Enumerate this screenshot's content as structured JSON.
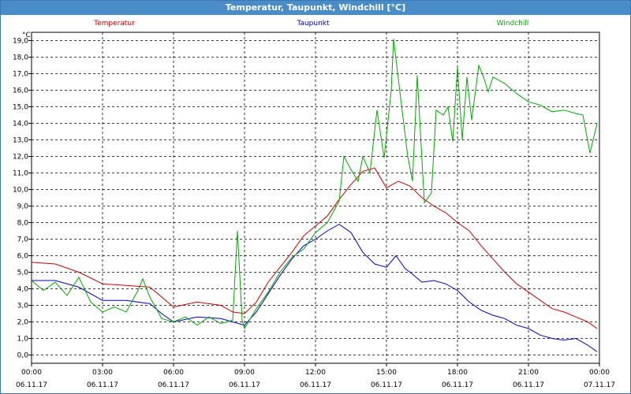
{
  "window": {
    "title": "Temperatur, Taupunkt, Windchill [°C]"
  },
  "chart_data": {
    "type": "line",
    "title": "Temperatur, Taupunkt, Windchill [°C]",
    "yunit": "°C",
    "ylim": [
      -0.5,
      19.5
    ],
    "yticks": [
      "19,0",
      "18,0",
      "17,0",
      "16,0",
      "15,0",
      "14,0",
      "13,0",
      "12,0",
      "11,0",
      "10,0",
      "9,0",
      "8,0",
      "7,0",
      "6,0",
      "5,0",
      "4,0",
      "3,0",
      "2,0",
      "1,0",
      "0,0"
    ],
    "xlim": [
      0,
      24
    ],
    "xticks": [
      {
        "time": "00:00",
        "date": "06.11.17"
      },
      {
        "time": "03:00",
        "date": "06.11.17"
      },
      {
        "time": "06:00",
        "date": "06.11.17"
      },
      {
        "time": "09:00",
        "date": "06.11.17"
      },
      {
        "time": "12:00",
        "date": "06.11.17"
      },
      {
        "time": "15:00",
        "date": "06.11.17"
      },
      {
        "time": "18:00",
        "date": "06.11.17"
      },
      {
        "time": "21:00",
        "date": "06.11.17"
      },
      {
        "time": "00:00",
        "date": "07.11.17"
      }
    ],
    "grid": true,
    "legend_position": "top",
    "series": [
      {
        "name": "Temperatur",
        "color": "#cc0000",
        "points": [
          [
            0,
            5.6
          ],
          [
            1,
            5.5
          ],
          [
            2,
            5.0
          ],
          [
            3,
            4.3
          ],
          [
            4,
            4.2
          ],
          [
            5,
            4.1
          ],
          [
            5.5,
            3.5
          ],
          [
            6,
            2.9
          ],
          [
            7,
            3.2
          ],
          [
            8,
            3.0
          ],
          [
            8.5,
            2.6
          ],
          [
            9,
            2.5
          ],
          [
            9.5,
            3.2
          ],
          [
            10,
            4.4
          ],
          [
            10.5,
            5.3
          ],
          [
            11,
            6.2
          ],
          [
            11.5,
            7.2
          ],
          [
            12,
            7.8
          ],
          [
            12.5,
            8.4
          ],
          [
            13,
            9.4
          ],
          [
            13.5,
            10.3
          ],
          [
            14,
            11.1
          ],
          [
            14.5,
            11.3
          ],
          [
            15,
            10.1
          ],
          [
            15.5,
            10.5
          ],
          [
            16,
            10.2
          ],
          [
            16.5,
            9.5
          ],
          [
            17,
            9.0
          ],
          [
            17.5,
            8.6
          ],
          [
            18,
            8.0
          ],
          [
            18.5,
            7.5
          ],
          [
            19,
            6.6
          ],
          [
            19.5,
            5.8
          ],
          [
            20,
            5.0
          ],
          [
            20.5,
            4.3
          ],
          [
            21,
            3.8
          ],
          [
            21.5,
            3.3
          ],
          [
            22,
            2.8
          ],
          [
            22.5,
            2.6
          ],
          [
            23,
            2.3
          ],
          [
            23.5,
            2.0
          ],
          [
            23.9,
            1.6
          ]
        ]
      },
      {
        "name": "Taupunkt",
        "color": "#0000cc",
        "points": [
          [
            0,
            4.5
          ],
          [
            1,
            4.5
          ],
          [
            2,
            4.1
          ],
          [
            3,
            3.3
          ],
          [
            4,
            3.3
          ],
          [
            5,
            3.1
          ],
          [
            5.5,
            2.5
          ],
          [
            6,
            2.0
          ],
          [
            7,
            2.3
          ],
          [
            8,
            2.2
          ],
          [
            8.5,
            2.0
          ],
          [
            9,
            1.8
          ],
          [
            9.5,
            2.6
          ],
          [
            10,
            3.7
          ],
          [
            10.5,
            4.8
          ],
          [
            11,
            5.8
          ],
          [
            11.5,
            6.6
          ],
          [
            12,
            7.0
          ],
          [
            12.5,
            7.5
          ],
          [
            13,
            7.9
          ],
          [
            13.5,
            7.4
          ],
          [
            14,
            6.2
          ],
          [
            14.5,
            5.5
          ],
          [
            15,
            5.3
          ],
          [
            15.4,
            6.0
          ],
          [
            15.8,
            5.2
          ],
          [
            16,
            5.0
          ],
          [
            16.5,
            4.4
          ],
          [
            17,
            4.5
          ],
          [
            17.5,
            4.3
          ],
          [
            18,
            3.9
          ],
          [
            18.5,
            3.2
          ],
          [
            19,
            2.7
          ],
          [
            19.5,
            2.4
          ],
          [
            20,
            2.2
          ],
          [
            20.5,
            1.8
          ],
          [
            21,
            1.6
          ],
          [
            21.5,
            1.2
          ],
          [
            22,
            1.0
          ],
          [
            22.5,
            0.9
          ],
          [
            23,
            1.0
          ],
          [
            23.5,
            0.6
          ],
          [
            23.9,
            0.2
          ]
        ]
      },
      {
        "name": "Windchill",
        "color": "#00aa00",
        "points": [
          [
            0,
            4.5
          ],
          [
            0.5,
            3.9
          ],
          [
            1,
            4.4
          ],
          [
            1.5,
            3.6
          ],
          [
            2,
            4.7
          ],
          [
            2.5,
            3.2
          ],
          [
            3,
            2.6
          ],
          [
            3.5,
            2.9
          ],
          [
            4,
            2.6
          ],
          [
            4.5,
            3.9
          ],
          [
            4.7,
            4.6
          ],
          [
            5,
            3.5
          ],
          [
            5.5,
            2.2
          ],
          [
            6,
            2.0
          ],
          [
            6.5,
            2.3
          ],
          [
            7,
            1.8
          ],
          [
            7.5,
            2.3
          ],
          [
            8,
            1.9
          ],
          [
            8.5,
            2.1
          ],
          [
            8.7,
            7.5
          ],
          [
            8.9,
            2.1
          ],
          [
            9,
            1.6
          ],
          [
            9.5,
            2.8
          ],
          [
            10,
            3.8
          ],
          [
            10.5,
            5.0
          ],
          [
            11,
            5.9
          ],
          [
            11.5,
            6.4
          ],
          [
            12,
            7.4
          ],
          [
            12.5,
            8.0
          ],
          [
            13,
            9.3
          ],
          [
            13.2,
            12.0
          ],
          [
            13.5,
            11.2
          ],
          [
            13.8,
            10.5
          ],
          [
            14,
            12.0
          ],
          [
            14.3,
            11.0
          ],
          [
            14.6,
            14.8
          ],
          [
            14.9,
            11.9
          ],
          [
            15.2,
            16.0
          ],
          [
            15.3,
            19.1
          ],
          [
            15.6,
            15.5
          ],
          [
            15.9,
            12.0
          ],
          [
            16.1,
            10.5
          ],
          [
            16.3,
            16.9
          ],
          [
            16.6,
            9.2
          ],
          [
            16.9,
            9.8
          ],
          [
            17.1,
            14.8
          ],
          [
            17.4,
            14.5
          ],
          [
            17.6,
            15.0
          ],
          [
            17.8,
            12.9
          ],
          [
            18.0,
            17.4
          ],
          [
            18.2,
            13.0
          ],
          [
            18.4,
            16.8
          ],
          [
            18.6,
            14.2
          ],
          [
            18.9,
            17.5
          ],
          [
            19.1,
            16.8
          ],
          [
            19.3,
            15.9
          ],
          [
            19.5,
            16.8
          ],
          [
            20,
            16.4
          ],
          [
            20.5,
            15.8
          ],
          [
            21,
            15.3
          ],
          [
            21.5,
            15.1
          ],
          [
            22,
            14.7
          ],
          [
            22.5,
            14.8
          ],
          [
            23,
            14.6
          ],
          [
            23.3,
            14.5
          ],
          [
            23.6,
            12.2
          ],
          [
            23.9,
            14.0
          ]
        ]
      }
    ]
  }
}
